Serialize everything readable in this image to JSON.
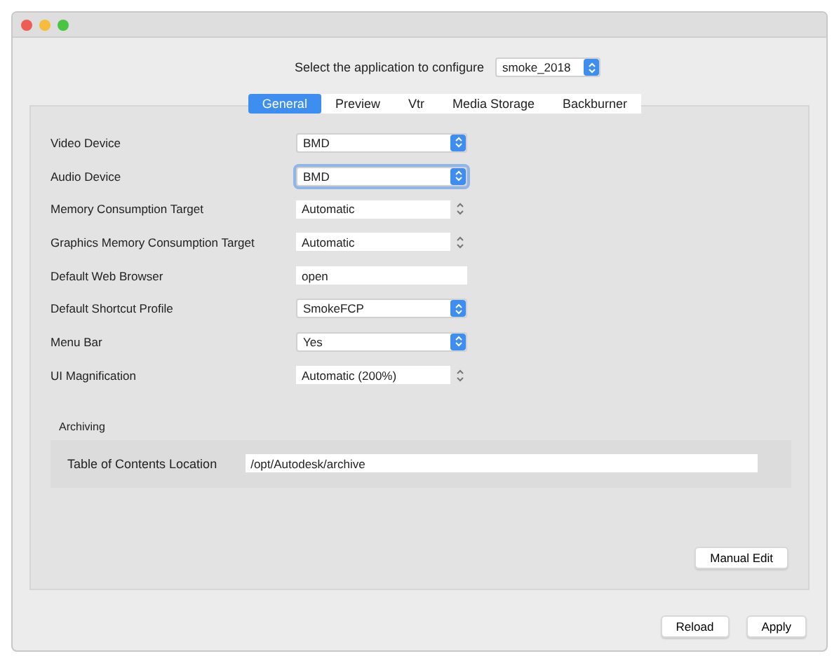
{
  "app_selector": {
    "label": "Select the application to configure",
    "value": "smoke_2018"
  },
  "tabs": [
    {
      "label": "General",
      "selected": true
    },
    {
      "label": "Preview",
      "selected": false
    },
    {
      "label": "Vtr",
      "selected": false
    },
    {
      "label": "Media Storage",
      "selected": false
    },
    {
      "label": "Backburner",
      "selected": false
    }
  ],
  "settings": [
    {
      "label": "Video Device",
      "kind": "popup",
      "value": "BMD",
      "focused": false
    },
    {
      "label": "Audio Device",
      "kind": "popup",
      "value": "BMD",
      "focused": true
    },
    {
      "label": "Memory Consumption Target",
      "kind": "combo",
      "value": "Automatic",
      "focused": false
    },
    {
      "label": "Graphics Memory Consumption Target",
      "kind": "combo",
      "value": "Automatic",
      "focused": false
    },
    {
      "label": "Default Web Browser",
      "kind": "text",
      "value": "open",
      "focused": false
    },
    {
      "label": "Default Shortcut Profile",
      "kind": "popup",
      "value": "SmokeFCP",
      "focused": false
    },
    {
      "label": "Menu Bar",
      "kind": "popup",
      "value": "Yes",
      "focused": false
    },
    {
      "label": "UI Magnification",
      "kind": "combo",
      "value": "Automatic (200%)",
      "focused": false
    }
  ],
  "archiving": {
    "title": "Archiving",
    "label": "Table of Contents Location",
    "value": "/opt/Autodesk/archive"
  },
  "buttons": {
    "manual_edit": "Manual Edit",
    "reload": "Reload",
    "apply": "Apply"
  }
}
